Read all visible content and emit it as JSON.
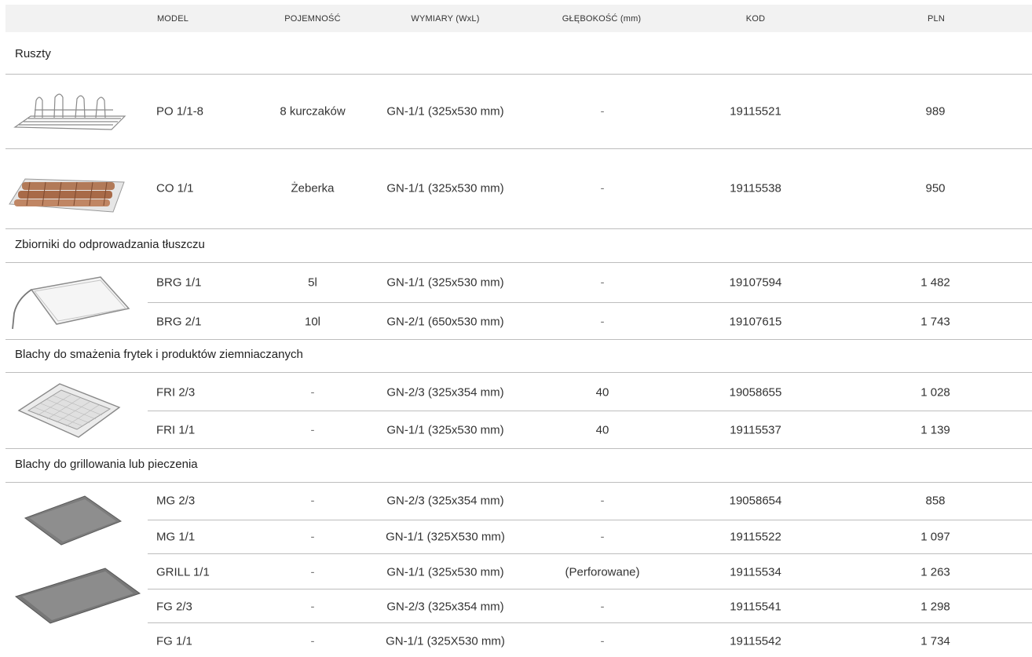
{
  "header": {
    "model": "MODEL",
    "capacity": "POJEMNOŚĆ",
    "dimensions": "WYMIARY (WxL)",
    "depth": "GŁĘBOKOŚĆ (mm)",
    "code": "KOD",
    "price": "PLN"
  },
  "sections": [
    {
      "title": "Ruszty"
    },
    {
      "title": "Zbiorniki do odprowadzania tłuszczu"
    },
    {
      "title": "Blachy do smażenia frytek i produktów ziemniaczanych"
    },
    {
      "title": "Blachy do grillowania lub pieczenia"
    }
  ],
  "rows": [
    {
      "model": "PO 1/1-8",
      "capacity": "8 kurczaków",
      "dimensions": "GN-1/1 (325x530 mm)",
      "depth": "-",
      "code": "19115521",
      "price": "989"
    },
    {
      "model": "CO 1/1",
      "capacity": "Żeberka",
      "dimensions": "GN-1/1 (325x530 mm)",
      "depth": "-",
      "code": "19115538",
      "price": "950"
    },
    {
      "model": "BRG 1/1",
      "capacity": "5l",
      "dimensions": "GN-1/1 (325x530 mm)",
      "depth": "-",
      "code": "19107594",
      "price": "1 482"
    },
    {
      "model": "BRG 2/1",
      "capacity": "10l",
      "dimensions": "GN-2/1 (650x530 mm)",
      "depth": "-",
      "code": "19107615",
      "price": "1 743"
    },
    {
      "model": "FRI 2/3",
      "capacity": "-",
      "dimensions": "GN-2/3 (325x354 mm)",
      "depth": "40",
      "code": "19058655",
      "price": "1 028"
    },
    {
      "model": "FRI 1/1",
      "capacity": "-",
      "dimensions": "GN-1/1 (325x530 mm)",
      "depth": "40",
      "code": "19115537",
      "price": "1 139"
    },
    {
      "model": "MG 2/3",
      "capacity": "-",
      "dimensions": "GN-2/3 (325x354 mm)",
      "depth": "-",
      "code": "19058654",
      "price": "858"
    },
    {
      "model": "MG 1/1",
      "capacity": "-",
      "dimensions": "GN-1/1 (325X530 mm)",
      "depth": "-",
      "code": "19115522",
      "price": "1 097"
    },
    {
      "model": "GRILL 1/1",
      "capacity": "-",
      "dimensions": "GN-1/1 (325x530 mm)",
      "depth": "(Perforowane)",
      "code": "19115534",
      "price": "1 263"
    },
    {
      "model": "FG 2/3",
      "capacity": "-",
      "dimensions": "GN-2/3 (325x354 mm)",
      "depth": "-",
      "code": "19115541",
      "price": "1 298"
    },
    {
      "model": "FG 1/1",
      "capacity": "-",
      "dimensions": "GN-1/1 (325X530 mm)",
      "depth": "-",
      "code": "19115542",
      "price": "1 734"
    }
  ]
}
